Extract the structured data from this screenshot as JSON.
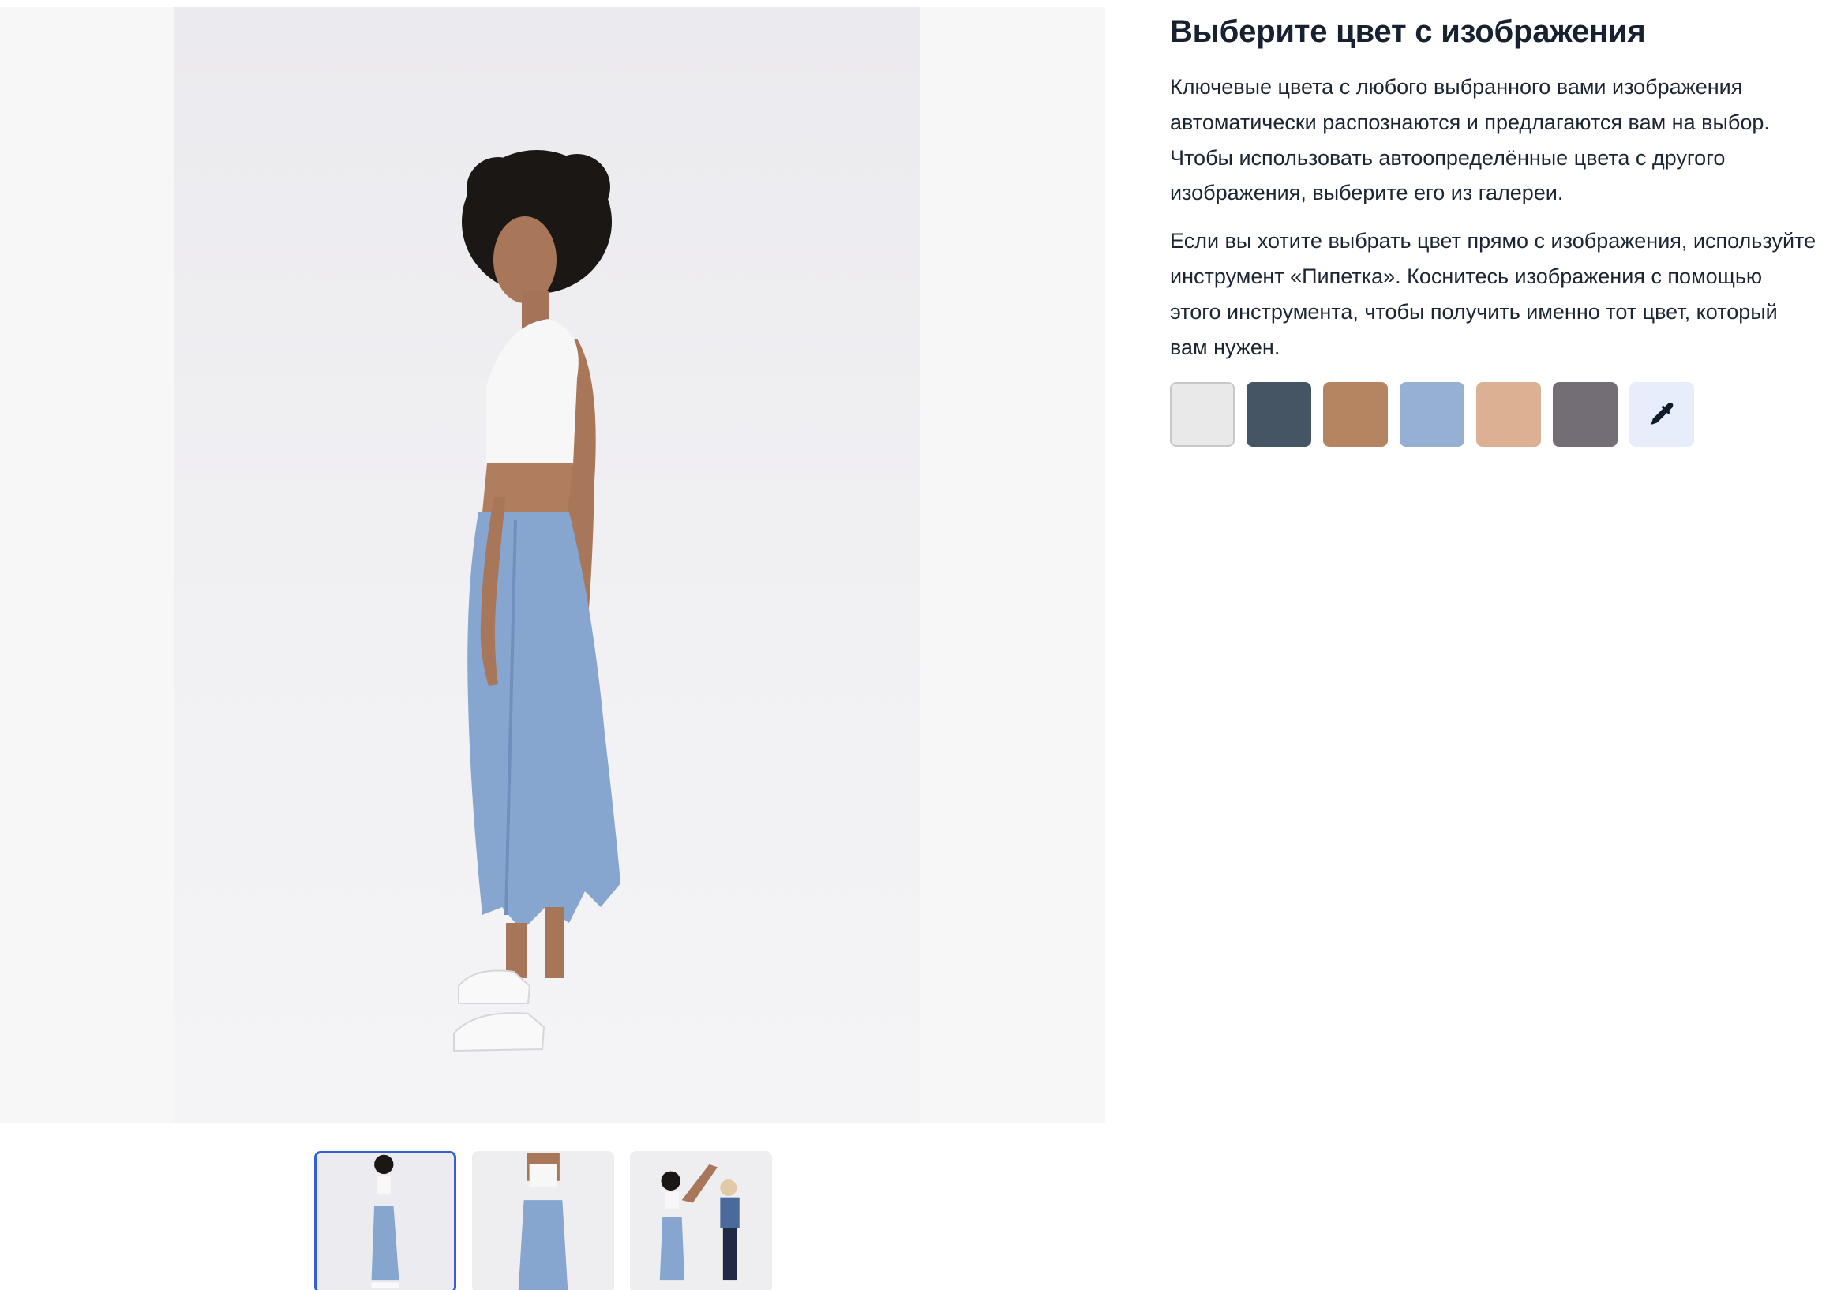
{
  "panel": {
    "title": "Выберите цвет с изображения",
    "paragraph1": "Ключевые цвета с любого выбранного вами изображения автоматически распознаются и предлагаются вам на выбор. Чтобы использовать автоопределённые цвета с другого изображения, выберите его из галереи.",
    "paragraph2": "Если вы хотите выбрать цвет прямо с изображения, используйте инструмент «Пипетка». Коснитесь изображения с помощью этого инструмента, чтобы получить именно тот цвет, который вам нужен.",
    "swatches": [
      "#e9e9e9",
      "#465564",
      "#b48560",
      "#95b0d3",
      "#dcb092",
      "#736e75"
    ],
    "eyedropper_icon": "eyedropper-icon"
  },
  "gallery": {
    "selected_index": 0,
    "thumbnail_count": 3,
    "accent_color": "#3560d4"
  }
}
